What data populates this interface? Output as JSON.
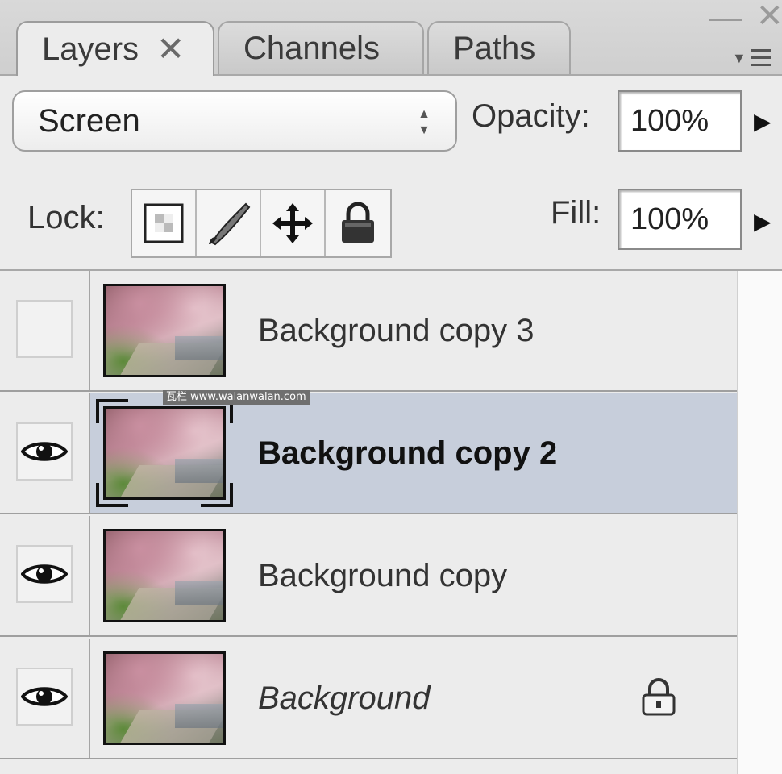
{
  "tabs": [
    {
      "label": "Layers",
      "active": true,
      "close": "✕"
    },
    {
      "label": "Channels",
      "active": false
    },
    {
      "label": "Paths",
      "active": false
    }
  ],
  "window_controls": {
    "minimize": "—",
    "close": "✕"
  },
  "blend": {
    "mode": "Screen",
    "opacity_label": "Opacity:",
    "opacity_value": "100%"
  },
  "lock": {
    "label": "Lock:",
    "icons": [
      "lock-transparent-icon",
      "lock-image-icon",
      "lock-position-icon",
      "lock-all-icon"
    ],
    "fill_label": "Fill:",
    "fill_value": "100%"
  },
  "layers": [
    {
      "name": "Background copy 3",
      "visible": false,
      "selected": false,
      "style": "normal",
      "locked": false
    },
    {
      "name": "Background copy 2",
      "visible": true,
      "selected": true,
      "style": "bold",
      "locked": false
    },
    {
      "name": "Background copy",
      "visible": true,
      "selected": false,
      "style": "normal",
      "locked": false
    },
    {
      "name": "Background",
      "visible": true,
      "selected": false,
      "style": "italic",
      "locked": true
    }
  ],
  "watermark": "瓦栏 www.walanwalan.com",
  "colors": {
    "selected_row": "#c7cedb",
    "panel_bg": "#ececec"
  }
}
